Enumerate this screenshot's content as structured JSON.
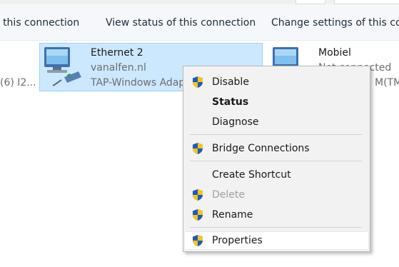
{
  "commands": {
    "disable": "e this connection",
    "view_status": "View status of this connection",
    "change_settings": "Change settings of this con"
  },
  "left_item": {
    "text": "(6) I2..."
  },
  "ethernet2": {
    "name": "Ethernet 2",
    "network": "vanalfen.nl",
    "device": "TAP-Windows Adap"
  },
  "mobiel": {
    "name": "Mobiel",
    "status": "Not connected",
    "device_trunc": "M(TM"
  },
  "menu": {
    "items": [
      {
        "label": "Disable",
        "icon": "uac-shield-icon"
      },
      {
        "label": "Status",
        "bold": true
      },
      {
        "label": "Diagnose"
      },
      {
        "label": "Bridge Connections",
        "icon": "uac-shield-icon"
      },
      {
        "label": "Create Shortcut"
      },
      {
        "label": "Delete",
        "icon": "uac-shield-icon",
        "disabled": true
      },
      {
        "label": "Rename",
        "icon": "uac-shield-icon"
      },
      {
        "label": "Properties",
        "icon": "uac-shield-icon",
        "hovered": true
      }
    ]
  },
  "colors": {
    "selection_bg": "#cce8ff",
    "selection_border": "#99d1ff",
    "menu_bg": "#f2f2f2",
    "shield_blue": "#1e5bbf",
    "shield_yellow": "#f5c518"
  }
}
